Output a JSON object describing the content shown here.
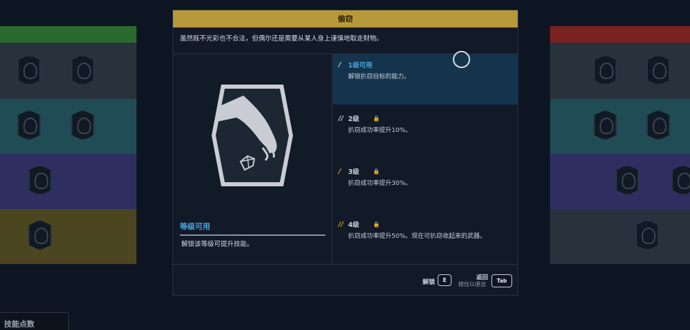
{
  "dialog": {
    "title": "偷窃",
    "description": "虽然既不光彩也不合法，但偶尔还是需要从某人身上谨慎地取走财物。"
  },
  "level_panel": {
    "title": "等级可用",
    "description": "解锁该等级可提升技能。"
  },
  "tiers": [
    {
      "name": "1级可用",
      "text": "解锁扒窃目标的能力。",
      "state": "active",
      "locked": false,
      "color": "#4aa3dd"
    },
    {
      "name": "2级",
      "text": "扒窃成功率提升10%。",
      "state": "locked",
      "locked": true,
      "color": "#c9d1dc"
    },
    {
      "name": "3级",
      "text": "扒窃成功率提升30%。",
      "state": "locked",
      "locked": true,
      "color": "#c9d1dc"
    },
    {
      "name": "4级",
      "text": "扒窃成功率提升50%。现在可扒窃收起来的武器。",
      "state": "locked",
      "locked": true,
      "color": "#c9d1dc"
    }
  ],
  "footer": {
    "unlock_label": "解锁",
    "unlock_key": "E",
    "back_label": "返回",
    "back_hint": "按住以退出",
    "back_key": "Tab"
  },
  "skill_points_label": "技能点数",
  "colors": {
    "header_gold": "#b8993a",
    "accent_blue": "#4aa3dd",
    "tier_marker_orange": "#e0a21e",
    "band_green": "#2b6a2e",
    "band_teal": "#1f4c55",
    "band_purple": "#2e2f60",
    "band_olive": "#4b4520",
    "band_red": "#7a2121"
  },
  "icons": [
    "thief-hand-diamond-emblem",
    "lock-icon",
    "cursor-ring"
  ]
}
